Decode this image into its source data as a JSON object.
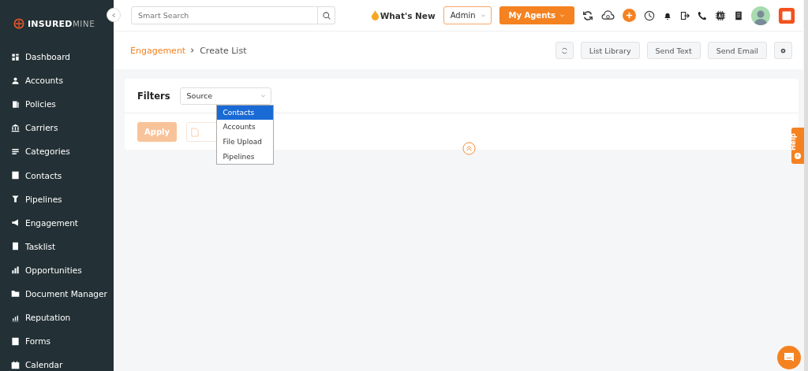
{
  "brand": {
    "bold": "INSURED",
    "light": "MINE"
  },
  "sidebar": {
    "items": [
      {
        "label": "Dashboard",
        "selected": false
      },
      {
        "label": "Accounts",
        "selected": false
      },
      {
        "label": "Policies",
        "selected": false
      },
      {
        "label": "Carriers",
        "selected": false
      },
      {
        "label": "Categories",
        "selected": false
      },
      {
        "label": "Contacts",
        "selected": false
      },
      {
        "label": "Pipelines",
        "selected": false
      },
      {
        "label": "Engagement",
        "selected": false
      },
      {
        "label": "Tasklist",
        "selected": false
      },
      {
        "label": "Opportunities",
        "selected": false
      },
      {
        "label": "Document Manager",
        "selected": false
      },
      {
        "label": "Reputation",
        "selected": false
      },
      {
        "label": "Forms",
        "selected": false
      },
      {
        "label": "Calendar",
        "selected": false
      }
    ]
  },
  "topbar": {
    "search": {
      "placeholder": "Smart Search"
    },
    "whats_new": "What's New",
    "role": "Admin",
    "agents": "My Agents"
  },
  "breadcrumb": {
    "parent": "Engagement",
    "current": "Create List"
  },
  "actions": [
    "List Library",
    "Send Text",
    "Send Email"
  ],
  "filters": {
    "label": "Filters",
    "select": "Source",
    "options": [
      {
        "label": "Contacts",
        "selected": true
      },
      {
        "label": "Accounts",
        "selected": false
      },
      {
        "label": "File Upload",
        "selected": false
      },
      {
        "label": "Pipelines",
        "selected": false
      }
    ],
    "apply": "Apply"
  },
  "help": "Help"
}
